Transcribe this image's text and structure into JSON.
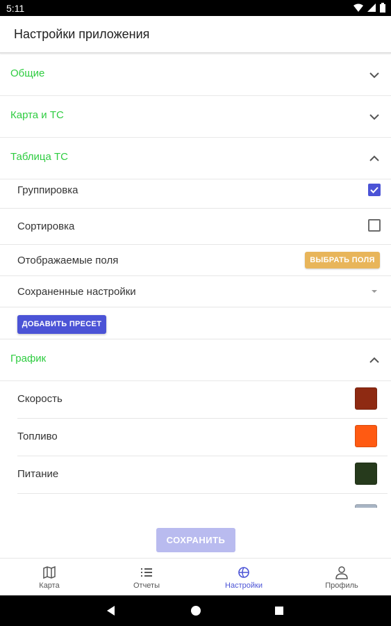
{
  "status_bar": {
    "time": "5:11"
  },
  "app_bar": {
    "title": "Настройки приложения"
  },
  "sections": {
    "general": {
      "label": "Общие",
      "expanded": false
    },
    "map": {
      "label": "Карта и ТС",
      "expanded": false
    },
    "table": {
      "label": "Таблица ТС",
      "expanded": true,
      "grouping": {
        "label": "Группировка",
        "checked": true
      },
      "sorting": {
        "label": "Сортировка",
        "checked": false
      },
      "fields": {
        "label": "Отображаемые поля",
        "button_label": "ВЫБРАТЬ ПОЛЯ"
      },
      "saved": {
        "label": "Сохраненные настройки"
      },
      "add_preset_label": "ДОБАВИТЬ ПРЕСЕТ"
    },
    "chart": {
      "label": "График",
      "expanded": true,
      "items": [
        {
          "label": "Скорость",
          "color": "#8e2a12"
        },
        {
          "label": "Топливо",
          "color": "#ff5a12"
        },
        {
          "label": "Питание",
          "color": "#263a1c"
        }
      ],
      "partial_color": "#a9b5c5"
    }
  },
  "save_button_label": "СОХРАНИТЬ",
  "bottom_nav": [
    {
      "label": "Карта",
      "icon": "map-icon",
      "active": false
    },
    {
      "label": "Отчеты",
      "icon": "list-icon",
      "active": false
    },
    {
      "label": "Настройки",
      "icon": "settings-icon",
      "active": true
    },
    {
      "label": "Профиль",
      "icon": "person-icon",
      "active": false
    }
  ],
  "colors": {
    "accent": "#4b53d6",
    "section_green": "#2ecc40",
    "fields_button": "#e8b55a"
  }
}
